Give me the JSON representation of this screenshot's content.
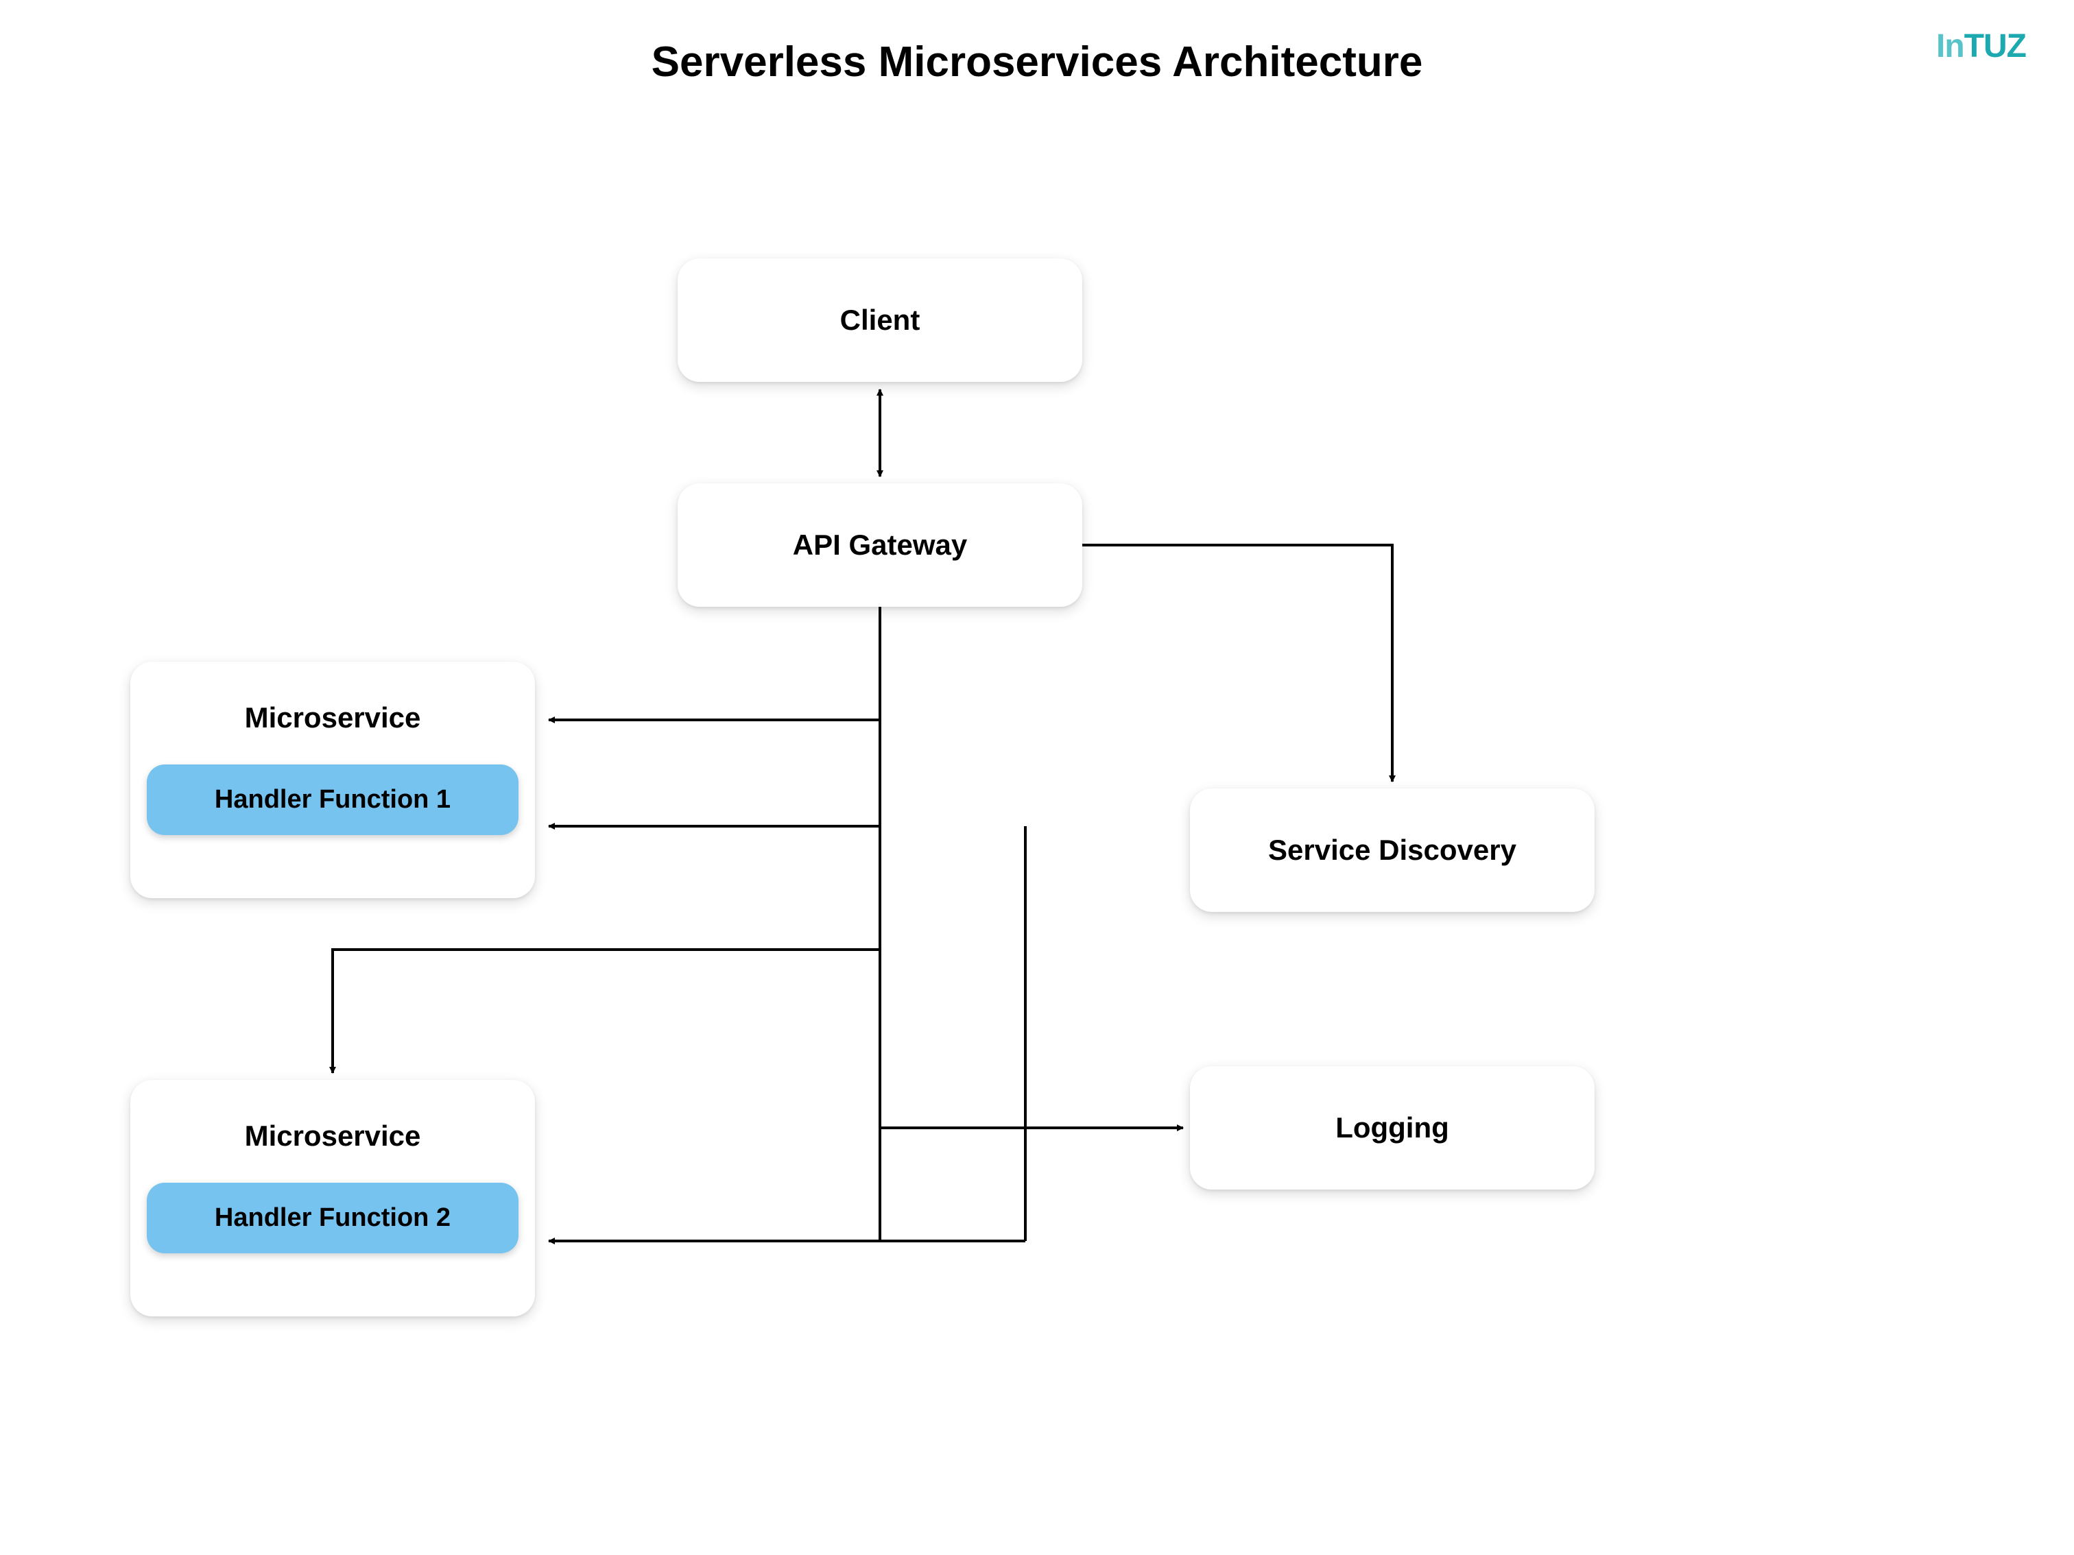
{
  "title": "Serverless Microservices Architecture",
  "logo": {
    "part1": "In",
    "part2": "TUZ"
  },
  "nodes": {
    "client": "Client",
    "apiGateway": "API Gateway",
    "microservice1": {
      "title": "Microservice",
      "handler": "Handler Function 1"
    },
    "microservice2": {
      "title": "Microservice",
      "handler": "Handler Function 2"
    },
    "serviceDiscovery": "Service Discovery",
    "logging": "Logging"
  }
}
